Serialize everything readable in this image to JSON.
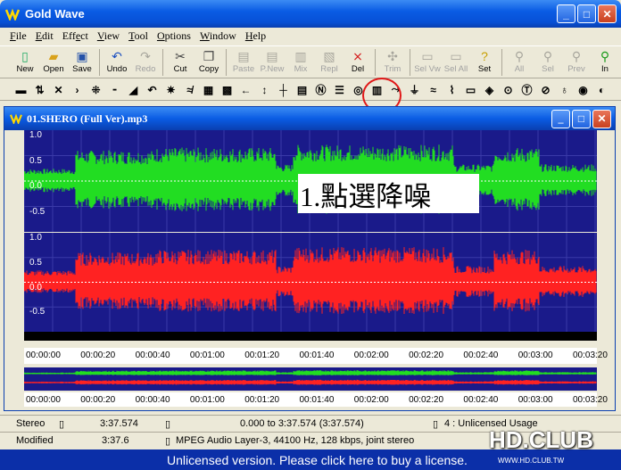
{
  "app": {
    "title": "Gold Wave"
  },
  "menu": [
    "File",
    "Edit",
    "Effect",
    "View",
    "Tool",
    "Options",
    "Window",
    "Help"
  ],
  "toolbar": [
    {
      "label": "New",
      "icon": "new-icon",
      "enabled": true
    },
    {
      "label": "Open",
      "icon": "open-icon",
      "enabled": true
    },
    {
      "label": "Save",
      "icon": "save-icon",
      "enabled": true
    },
    {
      "label": "Undo",
      "icon": "undo-icon",
      "enabled": true
    },
    {
      "label": "Redo",
      "icon": "redo-icon",
      "enabled": false
    },
    {
      "label": "Cut",
      "icon": "cut-icon",
      "enabled": true
    },
    {
      "label": "Copy",
      "icon": "copy-icon",
      "enabled": true
    },
    {
      "label": "Paste",
      "icon": "paste-icon",
      "enabled": false
    },
    {
      "label": "P.New",
      "icon": "paste-new-icon",
      "enabled": false
    },
    {
      "label": "Mix",
      "icon": "mix-icon",
      "enabled": false
    },
    {
      "label": "Repl",
      "icon": "replace-icon",
      "enabled": false
    },
    {
      "label": "Del",
      "icon": "delete-icon",
      "enabled": true
    },
    {
      "label": "Trim",
      "icon": "trim-icon",
      "enabled": false
    },
    {
      "label": "Sel Vw",
      "icon": "select-view-icon",
      "enabled": false
    },
    {
      "label": "Sel All",
      "icon": "select-all-icon",
      "enabled": false
    },
    {
      "label": "Set",
      "icon": "set-icon",
      "enabled": true
    },
    {
      "label": "All",
      "icon": "zoom-all-icon",
      "enabled": false
    },
    {
      "label": "Sel",
      "icon": "zoom-sel-icon",
      "enabled": false
    },
    {
      "label": "Prev",
      "icon": "zoom-prev-icon",
      "enabled": false
    },
    {
      "label": "In",
      "icon": "zoom-in-icon",
      "enabled": true
    }
  ],
  "document": {
    "title": "01.SHERO (Full Ver).mp3"
  },
  "channels": [
    {
      "color": "#22dd22",
      "ylabels": [
        "1.0",
        "0.5",
        "0.0",
        "-0.5"
      ]
    },
    {
      "color": "#ff2222",
      "ylabels": [
        "1.0",
        "0.5",
        "0.0",
        "-0.5"
      ]
    }
  ],
  "time_ticks": [
    "00:00:00",
    "00:00:20",
    "00:00:40",
    "00:01:00",
    "00:01:20",
    "00:01:40",
    "00:02:00",
    "00:02:20",
    "00:02:40",
    "00:03:00",
    "00:03:20"
  ],
  "annotation": "1.點選降噪",
  "status": {
    "row1": {
      "channels": "Stereo",
      "length": "3:37.574",
      "selection": "0.000 to 3:37.574 (3:37.574)",
      "license": "4 : Unlicensed Usage"
    },
    "row2": {
      "state": "Modified",
      "position": "3:37.6",
      "format": "MPEG Audio Layer-3, 44100 Hz, 128 kbps, joint stereo"
    }
  },
  "license_bar": "Unlicensed version. Please click here to buy a license.",
  "watermark": {
    "logo": "HD.CLUB",
    "url": "WWW.HD.CLUB.TW"
  }
}
